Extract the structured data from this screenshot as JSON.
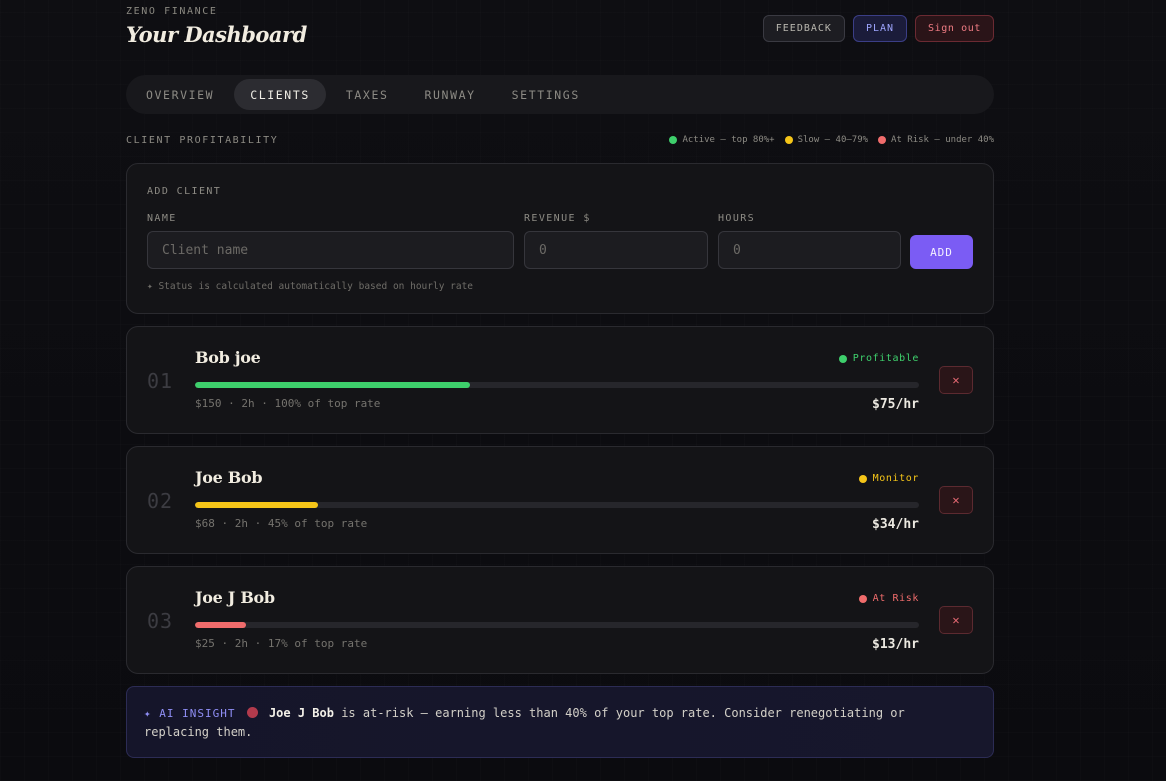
{
  "header": {
    "brand": "ZENO FINANCE",
    "title": "Your Dashboard",
    "buttons": {
      "feedback": "FEEDBACK",
      "plan": "PLAN",
      "signout": "Sign out"
    }
  },
  "tabs": [
    {
      "label": "OVERVIEW",
      "active": false
    },
    {
      "label": "CLIENTS",
      "active": true
    },
    {
      "label": "TAXES",
      "active": false
    },
    {
      "label": "RUNWAY",
      "active": false
    },
    {
      "label": "SETTINGS",
      "active": false
    }
  ],
  "section": {
    "label": "CLIENT PROFITABILITY",
    "legend": [
      {
        "label": "Active — top 80%+",
        "color": "#3ecf6c"
      },
      {
        "label": "Slow — 40–79%",
        "color": "#f5c518"
      },
      {
        "label": "At Risk — under 40%",
        "color": "#f06c6c"
      }
    ]
  },
  "add_client": {
    "title": "ADD CLIENT",
    "name_label": "NAME",
    "name_placeholder": "Client name",
    "revenue_label": "REVENUE $",
    "revenue_placeholder": "0",
    "hours_label": "HOURS",
    "hours_placeholder": "0",
    "add_label": "ADD",
    "hint": "✦ Status is calculated automatically based on hourly rate"
  },
  "clients": [
    {
      "num": "01",
      "name": "Bob joe",
      "status": "Profitable",
      "status_color": "#3ecf6c",
      "progress": 0.38,
      "meta": "$150 · 2h · 100% of top rate",
      "rate": "$75/hr",
      "delete_icon": "✕"
    },
    {
      "num": "02",
      "name": "Joe Bob",
      "status": "Monitor",
      "status_color": "#f5c518",
      "progress": 0.17,
      "meta": "$68 · 2h · 45% of top rate",
      "rate": "$34/hr",
      "delete_icon": "✕"
    },
    {
      "num": "03",
      "name": "Joe J Bob",
      "status": "At Risk",
      "status_color": "#f06c6c",
      "progress": 0.07,
      "meta": "$25 · 2h · 17% of top rate",
      "rate": "$13/hr",
      "delete_icon": "✕"
    }
  ],
  "insight": {
    "tag": "✦ AI INSIGHT",
    "client": "Joe J Bob",
    "text": " is at-risk — earning less than 40% of your top rate. Consider renegotiating or replacing them."
  }
}
